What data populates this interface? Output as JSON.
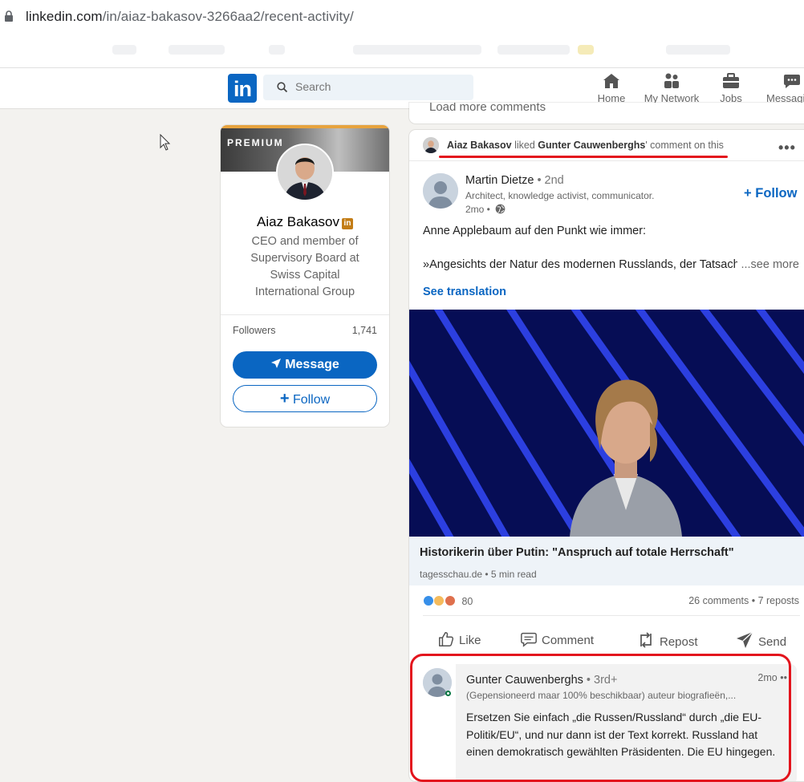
{
  "browser": {
    "url_domain": "linkedin.com",
    "url_path": "/in/aiaz-bakasov-3266aa2/recent-activity/"
  },
  "nav": {
    "logo": "in",
    "search_placeholder": "Search",
    "items": [
      {
        "label": "Home",
        "icon": "home-icon"
      },
      {
        "label": "My Network",
        "icon": "network-icon"
      },
      {
        "label": "Jobs",
        "icon": "briefcase-icon"
      },
      {
        "label": "Messagi",
        "icon": "messaging-icon"
      }
    ]
  },
  "profile": {
    "badge": "PREMIUM",
    "name": "Aiaz Bakasov",
    "headline": "CEO and member of Supervisory Board at Swiss Capital International Group",
    "followers_label": "Followers",
    "followers_count": "1,741",
    "message_label": "Message",
    "follow_label": "Follow",
    "accent_color": "#0a66c2",
    "premium_color": "#e7a33e"
  },
  "feed": {
    "load_more": "Load more comments",
    "activity": {
      "actor": "Aiaz Bakasov",
      "verb": " liked ",
      "target": "Gunter Cauwenberghs",
      "suffix": "' comment on this"
    },
    "post": {
      "author": "Martin Dietze",
      "degree": " • 2nd",
      "subtitle": "Architect, knowledge activist, communicator.",
      "time": "2mo •",
      "follow_label": "Follow",
      "text_line1": "Anne Applebaum auf den Punkt wie immer:",
      "text_line2": "»Angesichts der Natur des modernen Russlands, der Tatsach",
      "see_more": "...see more",
      "see_translation": "See translation",
      "link_title": "Historikerin über Putin: \"Anspruch auf totale Herrschaft\"",
      "link_source": "tagesschau.de • 5 min read",
      "reaction_count": "80",
      "stats": "26 comments • 7 reposts",
      "actions": [
        "Like",
        "Comment",
        "Repost",
        "Send"
      ]
    },
    "comment": {
      "author": "Gunter Cauwenberghs",
      "degree": " • 3rd+",
      "time": "2mo",
      "subtitle": "(Gepensioneerd maar 100% beschikbaar) auteur biografieën,...",
      "text": "Ersetzen Sie einfach „die Russen/Russland“ durch „die EU-Politik/EU“, und nur dann ist der Text korrekt. Russland hat einen demokratisch gewählten Präsidenten. Die EU hingegen."
    }
  },
  "annotation_color": "#e3141d"
}
